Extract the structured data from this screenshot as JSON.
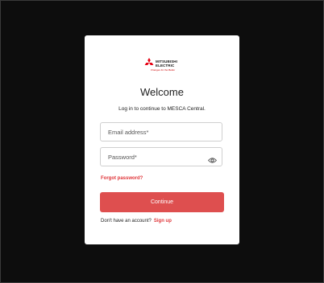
{
  "logo": {
    "brand_line1": "MITSUBISHI",
    "brand_line2": "ELECTRIC",
    "tagline": "Changes for the Better",
    "mark_color": "#e60012"
  },
  "login": {
    "title": "Welcome",
    "subtitle": "Log in to continue to MESCA Central.",
    "email_placeholder": "Email address*",
    "email_value": "",
    "password_placeholder": "Password*",
    "password_value": "",
    "password_toggle_icon": "eye-icon",
    "forgot_label": "Forgot password?",
    "continue_label": "Continue",
    "signup_prompt": "Don't have an account?",
    "signup_label": "Sign up"
  },
  "colors": {
    "accent": "#de4f4f",
    "link": "#e0363a",
    "background": "#0d0d0d",
    "card": "#ffffff"
  }
}
